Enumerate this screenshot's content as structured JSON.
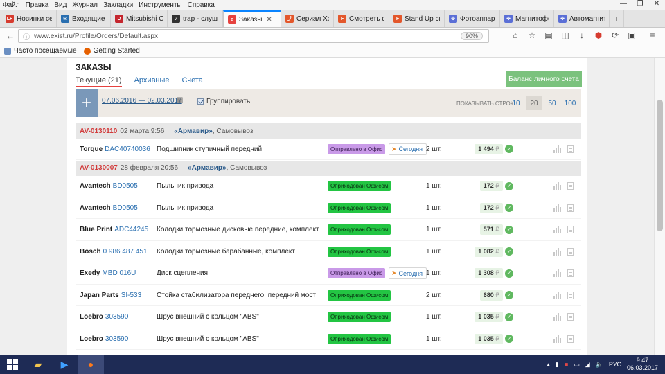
{
  "menu": [
    "Файл",
    "Правка",
    "Вид",
    "Журнал",
    "Закладки",
    "Инструменты",
    "Справка"
  ],
  "tabs": [
    {
      "label": "Новинки се...",
      "fav": "LF",
      "color": "#d63b2f"
    },
    {
      "label": "Входящие - ...",
      "fav": "✉",
      "color": "#2a6fb0"
    },
    {
      "label": "Mitsubishi C...",
      "fav": "D",
      "color": "#c4262e"
    },
    {
      "label": "trap - слуша...",
      "fav": "♪",
      "color": "#333333"
    },
    {
      "label": "Заказы",
      "fav": "e",
      "color": "#e6423f",
      "active": true
    },
    {
      "label": "Сериал Ход...",
      "fav": "⤴",
      "color": "#e3572b"
    },
    {
      "label": "Смотреть ф...",
      "fav": "F",
      "color": "#e3572b"
    },
    {
      "label": "Stand Up см...",
      "fav": "F",
      "color": "#e3572b"
    },
    {
      "label": "Фотоаппара...",
      "fav": "✤",
      "color": "#5b6fd6"
    },
    {
      "label": "Магнитофо...",
      "fav": "✤",
      "color": "#5b6fd6"
    },
    {
      "label": "Автомагнит...",
      "fav": "✤",
      "color": "#5b6fd6"
    }
  ],
  "nav": {
    "url": "www.exist.ru/Profile/Orders/Default.aspx",
    "zoom": "90%"
  },
  "bookmarks": [
    "Часто посещаемые",
    "Getting Started"
  ],
  "page": {
    "title": "ЗАКАЗЫ",
    "tabs": [
      "Текущие (21)",
      "Архивные",
      "Счета"
    ],
    "balance_button": "Баланс личного счета",
    "date_range": "07.06.2016 — 02.03.2017",
    "group_label": "Группировать",
    "rows_label": "Показывать строк:",
    "rows_options": [
      "10",
      "20",
      "50",
      "100"
    ]
  },
  "groups": [
    {
      "number": "AV-0130110",
      "date": "02 марта 9:56",
      "office": "«Армавир»",
      "delivery": ", Самовывоз",
      "items": [
        {
          "brand": "Torque",
          "code": "DAC40740036",
          "desc": "Подшипник ступичный передний",
          "status": "Отправлено в Офис",
          "status_type": "purple",
          "today": "Сегодня",
          "qty": "2 шт.",
          "price": "1 494"
        }
      ]
    },
    {
      "number": "AV-0130007",
      "date": "28 февраля 20:56",
      "office": "«Армавир»",
      "delivery": ", Самовывоз",
      "items": [
        {
          "brand": "Avantech",
          "code": "BD0505",
          "desc": "Пыльник привода",
          "status": "Оприходован Офисом",
          "status_type": "green",
          "today": "",
          "qty": "1 шт.",
          "price": "172"
        },
        {
          "brand": "Avantech",
          "code": "BD0505",
          "desc": "Пыльник привода",
          "status": "Оприходован Офисом",
          "status_type": "green",
          "today": "",
          "qty": "1 шт.",
          "price": "172"
        },
        {
          "brand": "Blue Print",
          "code": "ADC44245",
          "desc": "Колодки тормозные дисковые передние, комплект",
          "status": "Оприходован Офисом",
          "status_type": "green",
          "today": "",
          "qty": "1 шт.",
          "price": "571"
        },
        {
          "brand": "Bosch",
          "code": "0 986 487 451",
          "desc": "Колодки тормозные барабанные, комплект",
          "status": "Оприходован Офисом",
          "status_type": "green",
          "today": "",
          "qty": "1 шт.",
          "price": "1 082"
        },
        {
          "brand": "Exedy",
          "code": "MBD 016U",
          "desc": "Диск сцепления",
          "status": "Отправлено в Офис",
          "status_type": "purple",
          "today": "Сегодня",
          "qty": "1 шт.",
          "price": "1 308"
        },
        {
          "brand": "Japan Parts",
          "code": "SI-533",
          "desc": "Стойка стабилизатора переднего, передний мост",
          "status": "Оприходован Офисом",
          "status_type": "green",
          "today": "",
          "qty": "2 шт.",
          "price": "680"
        },
        {
          "brand": "Loebro",
          "code": "303590",
          "desc": "Шрус внешний с кольцом \"ABS\"",
          "status": "Оприходован Офисом",
          "status_type": "green",
          "today": "",
          "qty": "1 шт.",
          "price": "1 035"
        },
        {
          "brand": "Loebro",
          "code": "303590",
          "desc": "Шрус внешний с кольцом \"ABS\"",
          "status": "Оприходован Офисом",
          "status_type": "green",
          "today": "",
          "qty": "1 шт.",
          "price": "1 035"
        }
      ]
    }
  ],
  "currency": "₽",
  "taskbar": {
    "lang": "РУС",
    "time": "9:47",
    "date": "06.03.2017"
  }
}
